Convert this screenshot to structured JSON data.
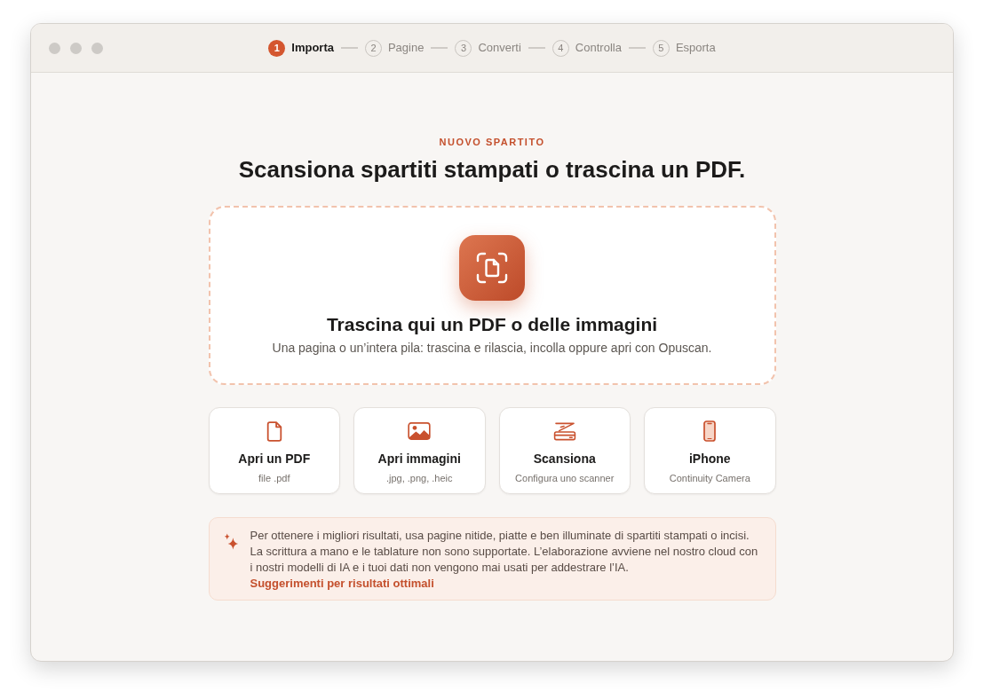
{
  "steps": [
    {
      "number": "1",
      "label": "Importa",
      "selected": true
    },
    {
      "number": "2",
      "label": "Pagine",
      "selected": false
    },
    {
      "number": "3",
      "label": "Converti",
      "selected": false
    },
    {
      "number": "4",
      "label": "Controlla",
      "selected": false
    },
    {
      "number": "5",
      "label": "Esporta",
      "selected": false
    }
  ],
  "header": {
    "eyebrow": "NUOVO SPARTITO",
    "title": "Scansiona spartiti stampati o trascina un PDF."
  },
  "dropzone": {
    "title": "Trascina qui un PDF o delle immagini",
    "subtitle": "Una pagina o un’intera pila: trascina e rilascia, incolla oppure apri con Opuscan."
  },
  "options": [
    {
      "kind": "pdf",
      "title": "Apri un PDF",
      "subtitle": "file .pdf"
    },
    {
      "kind": "images",
      "title": "Apri immagini",
      "subtitle": ".jpg, .png, .heic"
    },
    {
      "kind": "scanner",
      "title": "Scansiona",
      "subtitle": "Configura uno scanner"
    },
    {
      "kind": "phone",
      "title": "iPhone",
      "subtitle": "Continuity Camera"
    }
  ],
  "tip": {
    "text": "Per ottenere i migliori risultati, usa pagine nitide, piatte e ben illuminate di spartiti stampati o incisi. La scrittura a mano e le tablature non sono supportate. L’elaborazione avviene nel nostro cloud con i nostri modelli di IA e i tuoi dati non vengono mai usati per addestrare l’IA.",
    "link": "Suggerimenti per risultati ottimali"
  }
}
